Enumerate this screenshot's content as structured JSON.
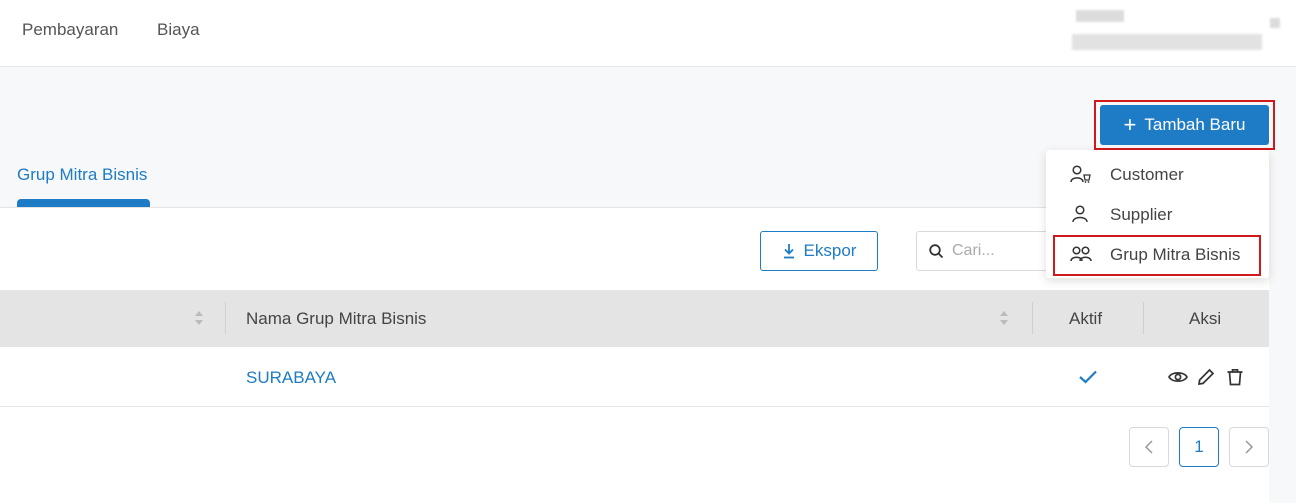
{
  "topnav": {
    "items": [
      {
        "label": "Pembayaran"
      },
      {
        "label": "Biaya"
      }
    ]
  },
  "header": {
    "add_button_label": "Tambah Baru"
  },
  "dropdown": {
    "items": [
      {
        "label": "Customer",
        "icon": "customer-icon"
      },
      {
        "label": "Supplier",
        "icon": "supplier-icon"
      },
      {
        "label": "Grup Mitra Bisnis",
        "icon": "group-icon"
      }
    ]
  },
  "tabs": [
    {
      "label": "Grup Mitra Bisnis",
      "active": true
    }
  ],
  "toolbar": {
    "export_label": "Ekspor",
    "search_placeholder": "Cari..."
  },
  "table": {
    "columns": [
      {
        "label": ""
      },
      {
        "label": "Nama Grup Mitra Bisnis"
      },
      {
        "label": "Aktif"
      },
      {
        "label": "Aksi"
      }
    ],
    "rows": [
      {
        "name": "SURABAYA",
        "active": true
      }
    ]
  },
  "pagination": {
    "current_page": "1"
  },
  "colors": {
    "accent": "#1e7bc5",
    "highlight": "#d0191d",
    "header_bg": "#e4e4e4"
  }
}
